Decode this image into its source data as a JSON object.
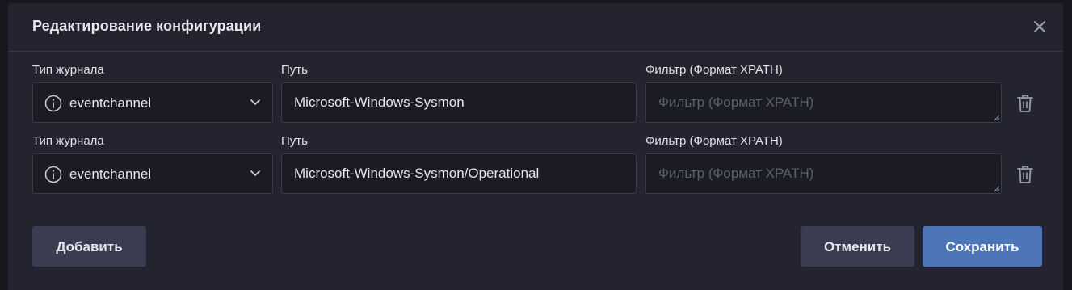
{
  "dialog": {
    "title": "Редактирование конфигурации",
    "close_icon": "close-icon"
  },
  "labels": {
    "log_type": "Тип журнала",
    "path": "Путь",
    "filter": "Фильтр (Формат XPATH)"
  },
  "rows": [
    {
      "log_type_value": "eventchannel",
      "path_value": "Microsoft-Windows-Sysmon",
      "filter_value": "",
      "filter_placeholder": "Фильтр (Формат XPATH)"
    },
    {
      "log_type_value": "eventchannel",
      "path_value": "Microsoft-Windows-Sysmon/Operational",
      "filter_value": "",
      "filter_placeholder": "Фильтр (Формат XPATH)"
    }
  ],
  "buttons": {
    "add": "Добавить",
    "cancel": "Отменить",
    "save": "Сохранить"
  },
  "colors": {
    "background": "#23242f",
    "input_background": "#1a1b23",
    "primary": "#4d76b9",
    "secondary": "#3a3d51"
  }
}
